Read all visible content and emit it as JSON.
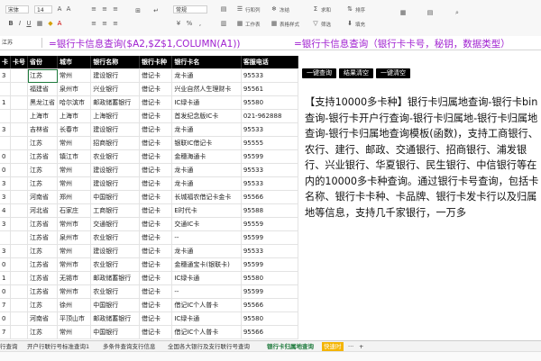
{
  "ribbon": {
    "font_name": "宋体",
    "font_size": "14",
    "number_format": "常规",
    "labels": [
      "行和列",
      "工作表",
      "冻结",
      "表格样式",
      "求和",
      "筛选",
      "排序",
      "填充"
    ]
  },
  "formula_bar": {
    "name_box": "江苏",
    "formula_left": "=银行卡信息查询($A2,$Z$1,COLUMN(A1))",
    "formula_right": "=银行卡信息查询（银行卡卡号，秘钥，数据类型）"
  },
  "table": {
    "headers": [
      "卡",
      "卡号",
      "省份",
      "城市",
      "银行名称",
      "银行卡种",
      "银行卡名",
      "客服电话"
    ],
    "rows": [
      [
        "3",
        "",
        "江苏",
        "常州",
        "建设银行",
        "借记卡",
        "龙卡通",
        "95533"
      ],
      [
        "",
        "",
        "福建省",
        "泉州市",
        "兴业银行",
        "借记卡",
        "兴业自然人生理财卡",
        "95561"
      ],
      [
        "1",
        "",
        "黑龙江省",
        "哈尔滨市",
        "邮政储蓄银行",
        "借记卡",
        "IC绿卡通",
        "95580"
      ],
      [
        "",
        "",
        "上海市",
        "上海市",
        "上海银行",
        "借记卡",
        "首发纪念版IC卡",
        "021-962888"
      ],
      [
        "3",
        "",
        "吉林省",
        "长春市",
        "建设银行",
        "借记卡",
        "龙卡通",
        "95533"
      ],
      [
        "",
        "",
        "江苏",
        "常州",
        "招商银行",
        "借记卡",
        "银联IC借记卡",
        "95555"
      ],
      [
        "0",
        "",
        "江苏省",
        "镇江市",
        "农业银行",
        "借记卡",
        "金穗海通卡",
        "95599"
      ],
      [
        "0",
        "",
        "江苏",
        "常州",
        "建设银行",
        "借记卡",
        "龙卡通",
        "95533"
      ],
      [
        "3",
        "",
        "江苏",
        "常州",
        "建设银行",
        "借记卡",
        "龙卡通",
        "95533"
      ],
      [
        "3",
        "",
        "河南省",
        "郑州",
        "中国银行",
        "借记卡",
        "长城福农借记卡金卡",
        "95566"
      ],
      [
        "4",
        "",
        "河北省",
        "石家庄",
        "工商银行",
        "借记卡",
        "E时代卡",
        "95588"
      ],
      [
        "3",
        "",
        "江苏省",
        "常州市",
        "交通银行",
        "借记卡",
        "交通IC卡",
        "95559"
      ],
      [
        "",
        "",
        "江苏省",
        "泉州市",
        "农业银行",
        "借记卡",
        "--",
        "95599"
      ],
      [
        "3",
        "",
        "江苏",
        "常州",
        "建设银行",
        "借记卡",
        "龙卡通",
        "95533"
      ],
      [
        "0",
        "",
        "江苏省",
        "常州市",
        "农业银行",
        "借记卡",
        "金穗通宝卡(银联卡)",
        "95599"
      ],
      [
        "1",
        "",
        "江苏省",
        "无锡市",
        "邮政储蓄银行",
        "借记卡",
        "IC绿卡通",
        "95580"
      ],
      [
        "0",
        "",
        "江苏省",
        "常州市",
        "农业银行",
        "借记卡",
        "--",
        "95599"
      ],
      [
        "7",
        "",
        "江苏",
        "徐州",
        "中国银行",
        "借记卡",
        "借记IC个人普卡",
        "95566"
      ],
      [
        "0",
        "",
        "河南省",
        "平顶山市",
        "邮政储蓄银行",
        "借记卡",
        "IC绿卡通",
        "95580"
      ],
      [
        "7",
        "",
        "江苏",
        "常州",
        "中国银行",
        "借记卡",
        "借记IC个人普卡",
        "95566"
      ]
    ]
  },
  "buttons": {
    "query": "一键查询",
    "clear_result": "结果清空",
    "clear_all": "一键清空"
  },
  "description": "【支持10000多卡种】银行卡归属地查询-银行卡bin查询-银行卡开户行查询-银行卡归属地-银行卡归属地查询-银行卡归属地查询模板(函数)，支持工商银行、农行、建行、邮政、交通银行、招商银行、浦发银行、兴业银行、华夏银行、民生银行、中信银行等在内的10000多卡种查询。通过银行卡号查询，包括卡名称、银行卡卡种、卡品牌、银行卡发卡行以及归属地等信息，支持几千家银行，一万多",
  "tabs": [
    "行查询",
    "开户行联行号标准查询1",
    "多条件查询支行信息",
    "全国各大银行及支行联行号查询",
    "银行卡归属地查询",
    "快速时"
  ],
  "active_tab": "银行卡归属地查询",
  "colors": {
    "formula": "#a020d0",
    "header_bg": "#000000",
    "active_tab": "#1e7a3c",
    "accent_tab": "#f4b400"
  }
}
